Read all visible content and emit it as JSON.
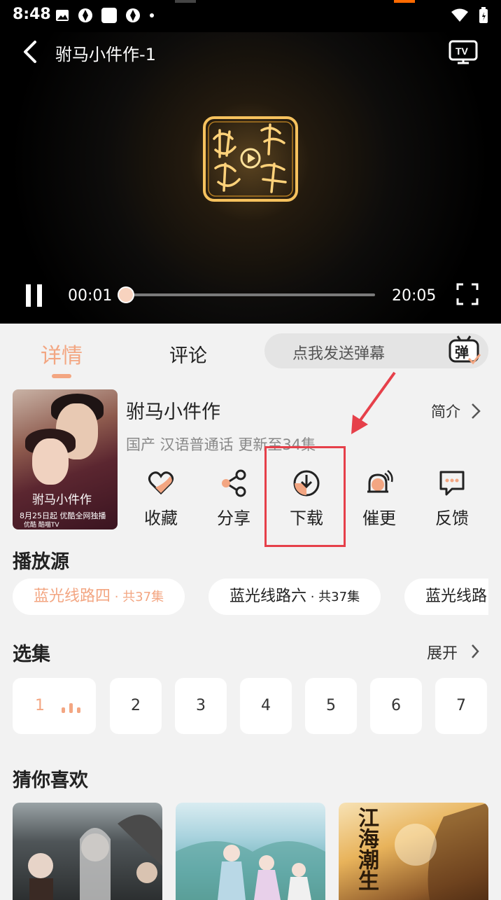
{
  "status_bar": {
    "time": "8:48"
  },
  "player": {
    "title": "驸马小件作-1",
    "current_time": "00:01",
    "duration": "20:05",
    "progress": 0.001
  },
  "tabs": {
    "detail": "详情",
    "comments": "评论"
  },
  "danmu": {
    "placeholder": "点我发送弹幕",
    "icon_label": "弹"
  },
  "show": {
    "title": "驸马小件作",
    "intro_label": "简介",
    "meta": "国产 汉语普通话 更新至34集",
    "poster_title": "驸马小件作",
    "poster_date": "8月25日起 优酷全网独播",
    "poster_footer": "优酷 酷喵TV"
  },
  "actions": [
    {
      "label": "收藏",
      "icon": "heart-icon"
    },
    {
      "label": "分享",
      "icon": "share-icon"
    },
    {
      "label": "下载",
      "icon": "download-icon"
    },
    {
      "label": "催更",
      "icon": "bell-icon"
    },
    {
      "label": "反馈",
      "icon": "feedback-icon"
    }
  ],
  "sources": {
    "title": "播放源",
    "items": [
      {
        "name": "蓝光线路四",
        "count": " · 共37集"
      },
      {
        "name": "蓝光线路六",
        "count": " · 共37集"
      },
      {
        "name": "蓝光线路",
        "count": ""
      }
    ]
  },
  "episodes": {
    "title": "选集",
    "expand_label": "展开",
    "items": [
      "1",
      "2",
      "3",
      "4",
      "5",
      "6",
      "7"
    ]
  },
  "recommend": {
    "title": "猜你喜欢",
    "poster3_text": "江海潮生"
  },
  "colors": {
    "accent": "#f3a682",
    "highlight": "#e6404a",
    "background": "#f2f2f2"
  }
}
